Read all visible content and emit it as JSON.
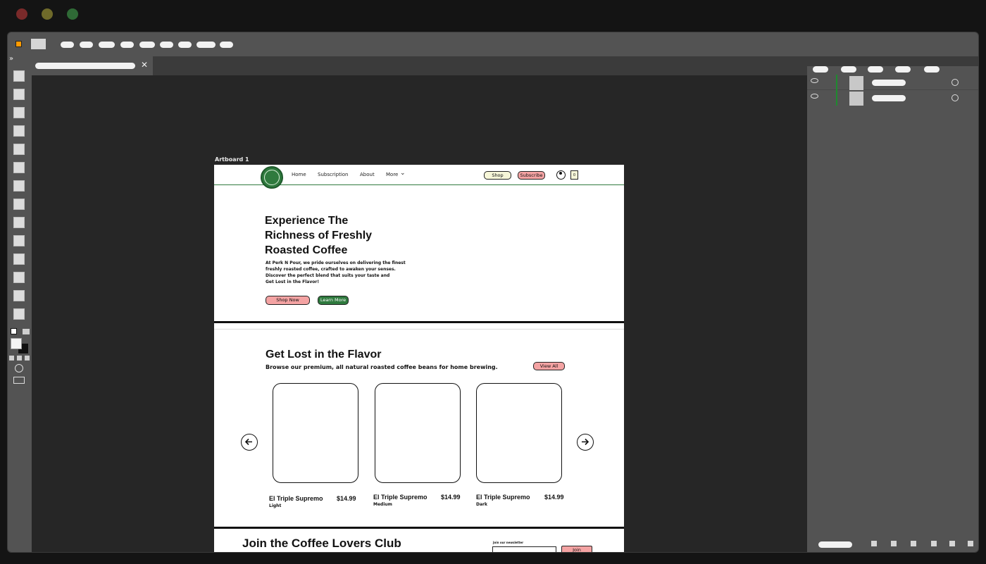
{
  "window": {
    "traffic_lights": [
      "close-light",
      "minimize-light",
      "zoom-light"
    ],
    "colors": {
      "close": "#7a2a2a",
      "minimize": "#6f6a2a",
      "zoom": "#2f6a36"
    }
  },
  "tab": {
    "close_glyph": "✕"
  },
  "artboard": {
    "label": "Artboard 1",
    "nav": {
      "items": [
        "Home",
        "Subscription",
        "About",
        "More"
      ],
      "more_caret": "⌄",
      "shop_label": "Shop",
      "subscribe_label": "Subscribe",
      "cart_count": "0"
    },
    "hero": {
      "title_line1": "Experience The",
      "title_line2": "Richness of Freshly",
      "title_line3": "Roasted Coffee",
      "body_line1": "At Perk N Pour, we pride ourselves on delivering the finest",
      "body_line2": "freshly roasted coffee, crafted to awaken your senses.",
      "body_line3": "Discover the perfect blend that suits your taste and",
      "body_line4": "Get Lost in the Flavor!",
      "shop_now": "Shop Now",
      "learn_more": "Learn More"
    },
    "products": {
      "title": "Get Lost in the Flavor",
      "subtitle": "Browse our premium, all natural roasted coffee beans for home brewing.",
      "view_all": "View All",
      "items": [
        {
          "name": "El Triple Supremo",
          "price": "$14.99",
          "roast": "Light"
        },
        {
          "name": "El Triple Supremo",
          "price": "$14.99",
          "roast": "Medium"
        },
        {
          "name": "El Triple Supremo",
          "price": "$14.99",
          "roast": "Dark"
        }
      ]
    },
    "club": {
      "title": "Join the Coffee Lovers Club",
      "newsletter_label": "Join our newsletter",
      "join_label": "Join"
    },
    "colors": {
      "accent_green": "#2f7a3e",
      "pink": "#f4a3a3",
      "cream": "#f6f6d8"
    }
  }
}
